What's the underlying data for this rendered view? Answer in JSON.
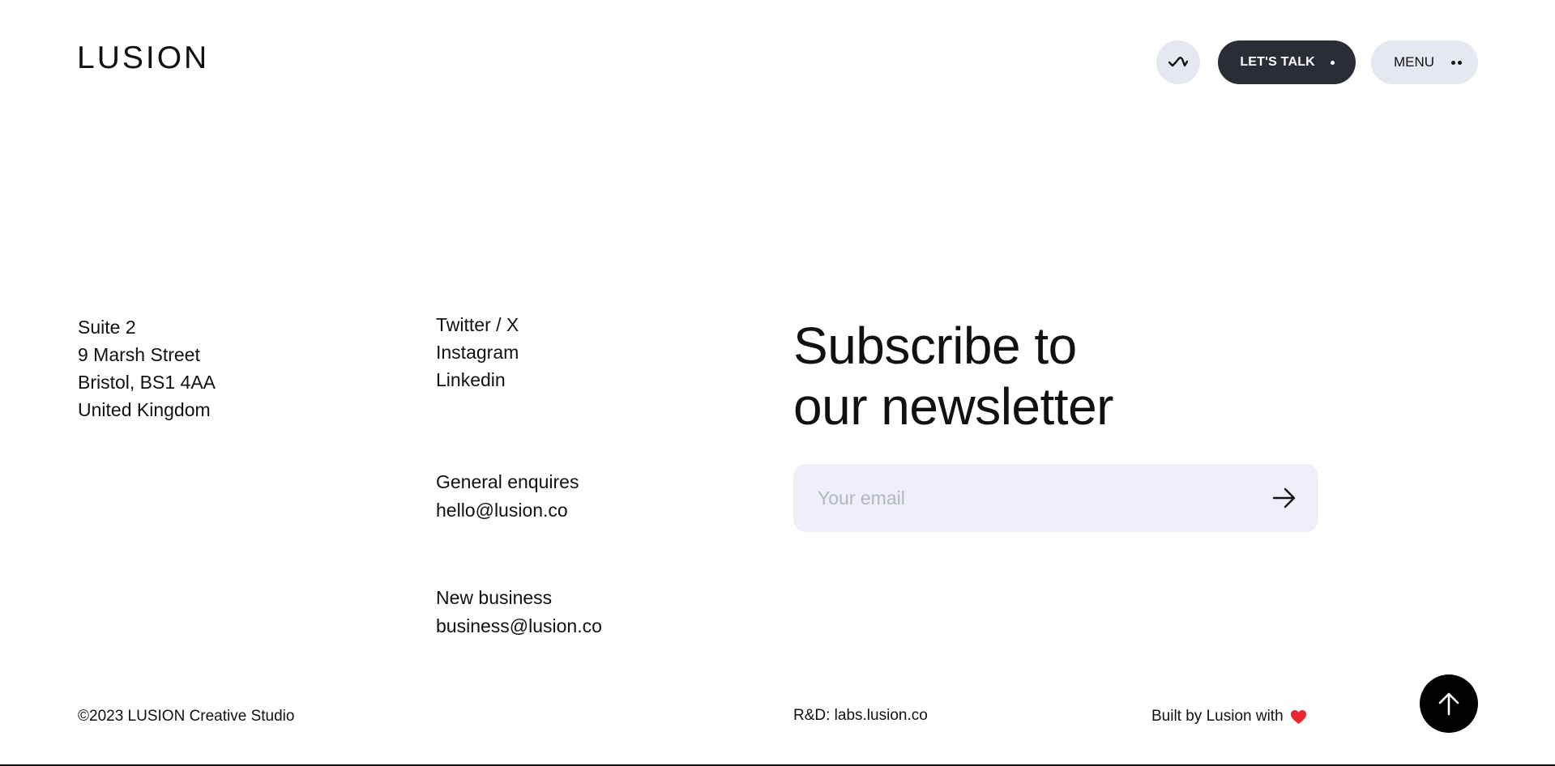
{
  "header": {
    "logo": "LUSION",
    "wave_icon": "sound-wave-icon",
    "talk_label": "LET'S TALK",
    "menu_label": "MENU"
  },
  "address": {
    "lines": [
      "Suite 2",
      "9 Marsh Street",
      "Bristol, BS1 4AA",
      "United Kingdom"
    ]
  },
  "socials": {
    "items": [
      "Twitter / X",
      "Instagram",
      "Linkedin"
    ]
  },
  "contacts": {
    "general": {
      "label": "General enquires",
      "email": "hello@lusion.co"
    },
    "business": {
      "label": "New business",
      "email": "business@lusion.co"
    }
  },
  "newsletter": {
    "title_line1": "Subscribe to",
    "title_line2": "our newsletter",
    "placeholder": "Your email",
    "submit_icon": "arrow-right-icon"
  },
  "footer": {
    "copyright": "©2023 LUSION Creative Studio",
    "rnd_label": "R&D: labs.lusion.co",
    "built_label": "Built by Lusion with",
    "heart_icon": "heart-icon",
    "heart_color": "#e8272f",
    "top_icon": "arrow-up-icon"
  },
  "colors": {
    "accent_dark": "#2a2d36",
    "pill_light": "#e5e8f0",
    "input_bg": "#eeeff8"
  }
}
